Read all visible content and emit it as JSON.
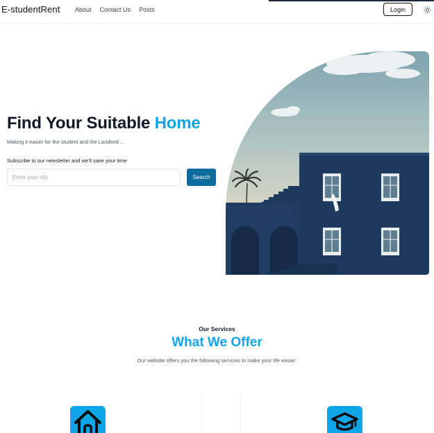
{
  "navbar": {
    "brand": "E-studentRent",
    "links": [
      "About",
      "Contact Us",
      "Posts"
    ],
    "login_label": "Login"
  },
  "hero": {
    "title_part1": "Find Your Suitable ",
    "title_accent": "Home",
    "subtitle": "Making it easier for the student and the Landlord ...",
    "newsletter_label": "Subscribe to our newsletter and we'll save your time",
    "search_placeholder": "Enter your city",
    "search_button": "Search"
  },
  "services": {
    "kicker": "Our Services",
    "title": "What We Offer",
    "description": "Our website offers you the following services to make your life easier:",
    "icons": [
      "home-icon",
      "graduation-cap-icon"
    ]
  },
  "colors": {
    "accent": "#0ea5e9",
    "button_primary": "#0b6a9e",
    "building": "#1c3b5f"
  }
}
